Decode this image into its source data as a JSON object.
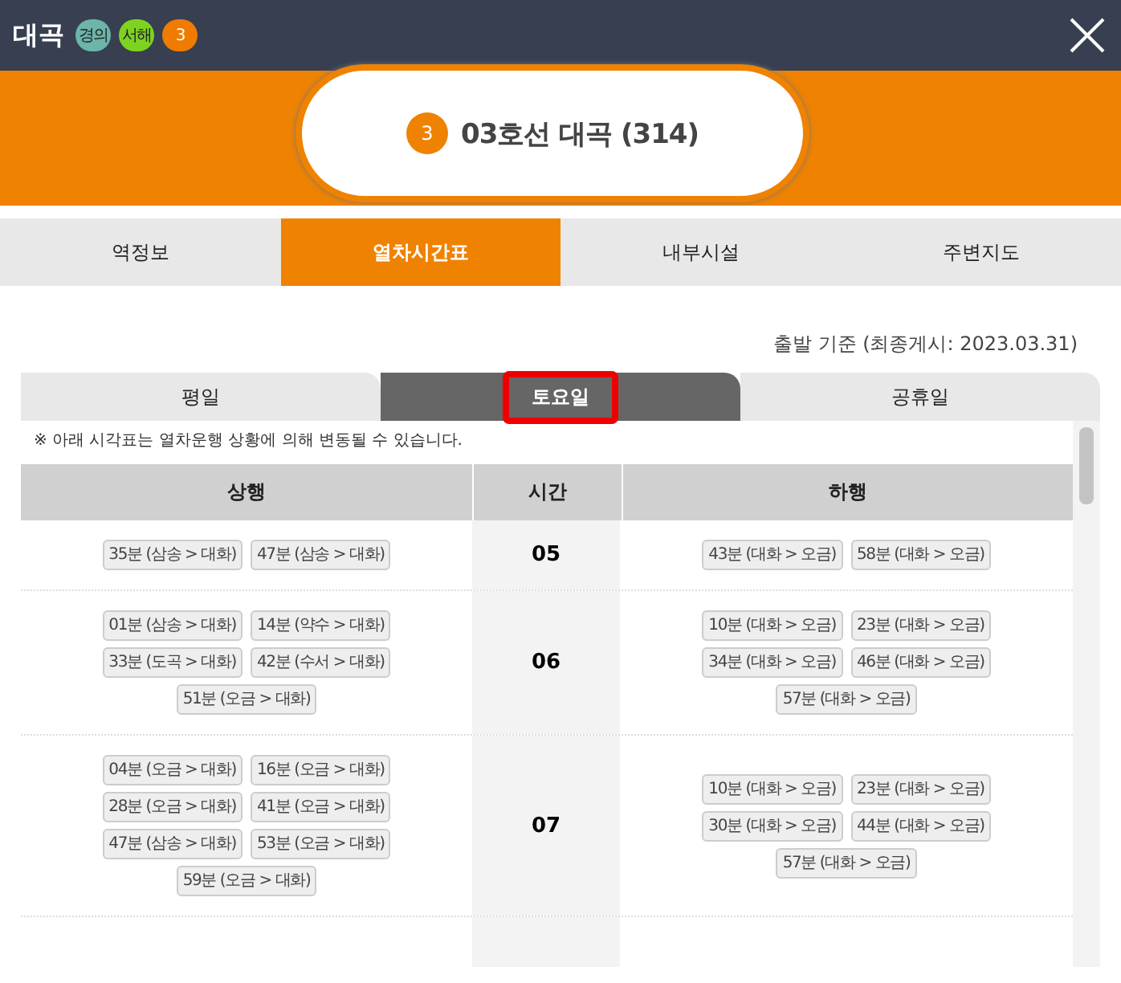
{
  "header": {
    "station": "대곡",
    "line_badges": [
      {
        "label": "경의",
        "color": "#6cb5a8"
      },
      {
        "label": "서해",
        "color": "#7ed321"
      },
      {
        "label": "3",
        "color": "#ef7c00"
      }
    ]
  },
  "station_card": {
    "line_number": "3",
    "title": "03호선 대곡 (314)"
  },
  "tabs": [
    {
      "label": "역정보",
      "selected": false
    },
    {
      "label": "열차시간표",
      "selected": true
    },
    {
      "label": "내부시설",
      "selected": false
    },
    {
      "label": "주변지도",
      "selected": false
    }
  ],
  "basis_note": "출발 기준 (최종게시: 2023.03.31)",
  "day_tabs": [
    {
      "label": "평일",
      "selected": false,
      "highlighted": false
    },
    {
      "label": "토요일",
      "selected": true,
      "highlighted": true
    },
    {
      "label": "공휴일",
      "selected": false,
      "highlighted": false
    }
  ],
  "notice": "※ 아래 시각표는 열차운행 상황에 의해 변동될 수 있습니다.",
  "table": {
    "columns": [
      "상행",
      "시간",
      "하행"
    ],
    "rows": [
      {
        "hour": "05",
        "up": [
          "35분 (삼송 > 대화)",
          "47분 (삼송 > 대화)"
        ],
        "down": [
          "43분 (대화 > 오금)",
          "58분 (대화 > 오금)"
        ]
      },
      {
        "hour": "06",
        "up": [
          "01분 (삼송 > 대화)",
          "14분 (약수 > 대화)",
          "33분 (도곡 > 대화)",
          "42분 (수서 > 대화)",
          "51분 (오금 > 대화)"
        ],
        "down": [
          "10분 (대화 > 오금)",
          "23분 (대화 > 오금)",
          "34분 (대화 > 오금)",
          "46분 (대화 > 오금)",
          "57분 (대화 > 오금)"
        ]
      },
      {
        "hour": "07",
        "up": [
          "04분 (오금 > 대화)",
          "16분 (오금 > 대화)",
          "28분 (오금 > 대화)",
          "41분 (오금 > 대화)",
          "47분 (삼송 > 대화)",
          "53분 (오금 > 대화)",
          "59분 (오금 > 대화)"
        ],
        "down": [
          "10분 (대화 > 오금)",
          "23분 (대화 > 오금)",
          "30분 (대화 > 오금)",
          "44분 (대화 > 오금)",
          "57분 (대화 > 오금)"
        ]
      }
    ]
  }
}
